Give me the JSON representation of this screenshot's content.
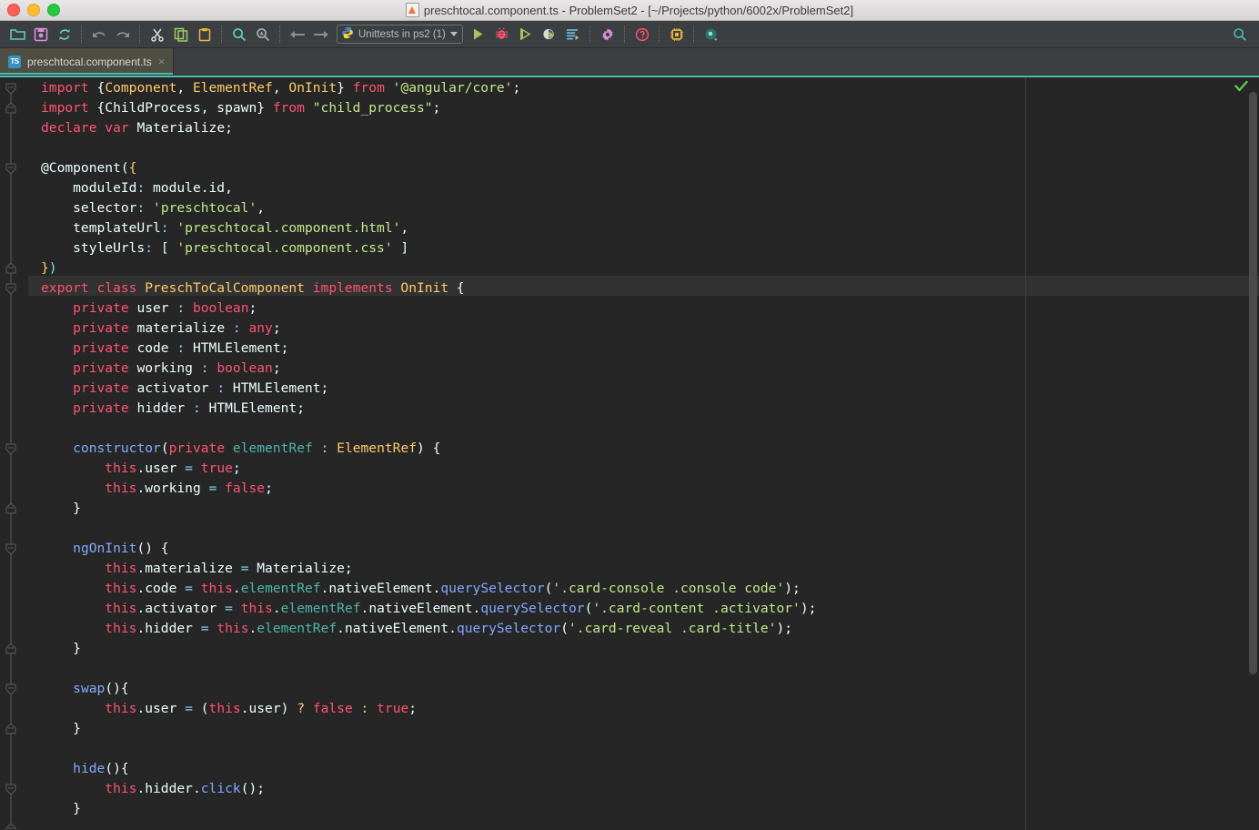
{
  "window": {
    "title": "preschtocal.component.ts - ProblemSet2 - [~/Projects/python/6002x/ProblemSet2]",
    "title_icon": "file-icon",
    "controls": [
      "close-button",
      "minimize-button",
      "zoom-button"
    ]
  },
  "toolbar": {
    "groups": [
      [
        {
          "name": "open-folder-icon",
          "glyph": "folder",
          "color": "#5fc9bf"
        },
        {
          "name": "save-all-icon",
          "glyph": "floppy",
          "color": "#d98fd9"
        },
        {
          "name": "sync-refresh-icon",
          "glyph": "refresh",
          "color": "#5fc9bf"
        }
      ],
      [
        {
          "name": "undo-icon",
          "glyph": "undo",
          "color": "#8d8d8d"
        },
        {
          "name": "redo-icon",
          "glyph": "redo",
          "color": "#8d8d8d"
        }
      ],
      [
        {
          "name": "cut-icon",
          "glyph": "scissors",
          "color": "#d8d8d8"
        },
        {
          "name": "copy-icon",
          "glyph": "copy",
          "color": "#9ccc65"
        },
        {
          "name": "paste-icon",
          "glyph": "clipboard",
          "color": "#e8b53a"
        }
      ],
      [
        {
          "name": "find-icon",
          "glyph": "magnifier",
          "color": "#5fc9bf"
        },
        {
          "name": "replace-icon",
          "glyph": "magnifier-replace",
          "color": "#a8a8a8"
        }
      ],
      [
        {
          "name": "back-icon",
          "glyph": "arrow-left",
          "color": "#8d8d8d"
        },
        {
          "name": "forward-icon",
          "glyph": "arrow-right",
          "color": "#8d8d8d"
        }
      ]
    ],
    "run_config": {
      "name": "run-configuration-selector",
      "icon": "python-icon",
      "label": "Unittests in ps2 (1)",
      "dropdown": "chevron-down-icon"
    },
    "actions": [
      {
        "name": "run-icon",
        "glyph": "play",
        "color": "#a5c261"
      },
      {
        "name": "debug-icon",
        "glyph": "bug",
        "color": "#ff5370"
      },
      {
        "name": "run-coverage-icon",
        "glyph": "play-outline",
        "color": "#a5c261"
      },
      {
        "name": "profile-icon",
        "glyph": "profile",
        "color": "#d8d8d8"
      },
      {
        "name": "run-with-console-icon",
        "glyph": "list-play",
        "color": "#6fb3d2"
      },
      {
        "name": "settings-icon",
        "glyph": "gear",
        "color": "#d98fd9"
      },
      {
        "name": "help-icon",
        "glyph": "question-circle",
        "color": "#ff5370"
      },
      {
        "name": "sdk-icon",
        "glyph": "chip",
        "color": "#e8b53a"
      },
      {
        "name": "search-everywhere-icon",
        "glyph": "circle-dot",
        "color": "#4db6ac"
      }
    ],
    "right_search": {
      "name": "search-icon",
      "glyph": "magnifier",
      "color": "#4db6ac"
    }
  },
  "tabs": [
    {
      "name": "tab-preschtocal-component-ts",
      "icon_text": "TS",
      "label": "preschtocal.component.ts",
      "close": "×",
      "active": true
    }
  ],
  "editor": {
    "status_check": "valid-checkmark",
    "caret_line": 10,
    "right_margin_column_x": 1127,
    "lines": [
      [
        {
          "t": "import ",
          "c": "kw"
        },
        {
          "t": "{",
          "c": "def"
        },
        {
          "t": "Component",
          "c": "cls"
        },
        {
          "t": ", ",
          "c": "def"
        },
        {
          "t": "ElementRef",
          "c": "cls"
        },
        {
          "t": ", ",
          "c": "def"
        },
        {
          "t": "OnInit",
          "c": "cls"
        },
        {
          "t": "} ",
          "c": "def"
        },
        {
          "t": "from ",
          "c": "kw"
        },
        {
          "t": "'@angular/core'",
          "c": "str"
        },
        {
          "t": ";",
          "c": "def"
        }
      ],
      [
        {
          "t": "import ",
          "c": "kw"
        },
        {
          "t": "{ChildProcess, spawn} ",
          "c": "def"
        },
        {
          "t": "from ",
          "c": "kw"
        },
        {
          "t": "\"child_process\"",
          "c": "str"
        },
        {
          "t": ";",
          "c": "def"
        }
      ],
      [
        {
          "t": "declare ",
          "c": "kw"
        },
        {
          "t": "var ",
          "c": "kw"
        },
        {
          "t": "Materialize;",
          "c": "def"
        }
      ],
      [],
      [
        {
          "t": "@Component(",
          "c": "def"
        },
        {
          "t": "{",
          "c": "brace-hl"
        }
      ],
      [
        {
          "t": "    moduleId",
          "c": "def"
        },
        {
          "t": ":",
          "c": "prop"
        },
        {
          "t": " module.id,",
          "c": "def"
        }
      ],
      [
        {
          "t": "    selector",
          "c": "def"
        },
        {
          "t": ":",
          "c": "prop"
        },
        {
          "t": " ",
          "c": "def"
        },
        {
          "t": "'preschtocal'",
          "c": "str"
        },
        {
          "t": ",",
          "c": "def"
        }
      ],
      [
        {
          "t": "    templateUrl",
          "c": "def"
        },
        {
          "t": ":",
          "c": "prop"
        },
        {
          "t": " ",
          "c": "def"
        },
        {
          "t": "'preschtocal.component.html'",
          "c": "str"
        },
        {
          "t": ",",
          "c": "def"
        }
      ],
      [
        {
          "t": "    styleUrls",
          "c": "def"
        },
        {
          "t": ":",
          "c": "prop"
        },
        {
          "t": " [ ",
          "c": "def"
        },
        {
          "t": "'preschtocal.component.css'",
          "c": "str"
        },
        {
          "t": " ]",
          "c": "def"
        }
      ],
      [
        {
          "t": "}",
          "c": "brace-hl"
        },
        {
          "t": ")",
          "c": "prop"
        }
      ],
      [
        {
          "t": "export ",
          "c": "kw"
        },
        {
          "t": "class ",
          "c": "kw"
        },
        {
          "t": "PreschToCalComponent ",
          "c": "cls"
        },
        {
          "t": "implements ",
          "c": "kw"
        },
        {
          "t": "OnInit",
          "c": "cls"
        },
        {
          "t": " {",
          "c": "def"
        }
      ],
      [
        {
          "t": "    ",
          "c": "def"
        },
        {
          "t": "private ",
          "c": "kw"
        },
        {
          "t": "user ",
          "c": "def"
        },
        {
          "t": ":",
          "c": "prop"
        },
        {
          "t": " ",
          "c": "def"
        },
        {
          "t": "boolean",
          "c": "kw"
        },
        {
          "t": ";",
          "c": "def"
        }
      ],
      [
        {
          "t": "    ",
          "c": "def"
        },
        {
          "t": "private ",
          "c": "kw"
        },
        {
          "t": "materialize ",
          "c": "def"
        },
        {
          "t": ":",
          "c": "prop"
        },
        {
          "t": " ",
          "c": "def"
        },
        {
          "t": "any",
          "c": "kw"
        },
        {
          "t": ";",
          "c": "def"
        }
      ],
      [
        {
          "t": "    ",
          "c": "def"
        },
        {
          "t": "private ",
          "c": "kw"
        },
        {
          "t": "code ",
          "c": "def"
        },
        {
          "t": ":",
          "c": "prop"
        },
        {
          "t": " HTMLElement;",
          "c": "def"
        }
      ],
      [
        {
          "t": "    ",
          "c": "def"
        },
        {
          "t": "private ",
          "c": "kw"
        },
        {
          "t": "working ",
          "c": "def"
        },
        {
          "t": ":",
          "c": "prop"
        },
        {
          "t": " ",
          "c": "def"
        },
        {
          "t": "boolean",
          "c": "kw"
        },
        {
          "t": ";",
          "c": "def"
        }
      ],
      [
        {
          "t": "    ",
          "c": "def"
        },
        {
          "t": "private ",
          "c": "kw"
        },
        {
          "t": "activator ",
          "c": "def"
        },
        {
          "t": ":",
          "c": "prop"
        },
        {
          "t": " HTMLElement;",
          "c": "def"
        }
      ],
      [
        {
          "t": "    ",
          "c": "def"
        },
        {
          "t": "private ",
          "c": "kw"
        },
        {
          "t": "hidder ",
          "c": "def"
        },
        {
          "t": ":",
          "c": "prop"
        },
        {
          "t": " HTMLElement;",
          "c": "def"
        }
      ],
      [],
      [
        {
          "t": "    ",
          "c": "def"
        },
        {
          "t": "constructor",
          "c": "fn"
        },
        {
          "t": "(",
          "c": "def"
        },
        {
          "t": "private ",
          "c": "kw"
        },
        {
          "t": "elementRef ",
          "c": "tealid"
        },
        {
          "t": ":",
          "c": "prop"
        },
        {
          "t": " ",
          "c": "def"
        },
        {
          "t": "ElementRef",
          "c": "cls"
        },
        {
          "t": ") {",
          "c": "def"
        }
      ],
      [
        {
          "t": "        ",
          "c": "def"
        },
        {
          "t": "this",
          "c": "kw"
        },
        {
          "t": ".user ",
          "c": "def"
        },
        {
          "t": "=",
          "c": "prop"
        },
        {
          "t": " ",
          "c": "def"
        },
        {
          "t": "true",
          "c": "kw"
        },
        {
          "t": ";",
          "c": "def"
        }
      ],
      [
        {
          "t": "        ",
          "c": "def"
        },
        {
          "t": "this",
          "c": "kw"
        },
        {
          "t": ".working ",
          "c": "def"
        },
        {
          "t": "=",
          "c": "prop"
        },
        {
          "t": " ",
          "c": "def"
        },
        {
          "t": "false",
          "c": "kw"
        },
        {
          "t": ";",
          "c": "def"
        }
      ],
      [
        {
          "t": "    }",
          "c": "def"
        }
      ],
      [],
      [
        {
          "t": "    ",
          "c": "def"
        },
        {
          "t": "ngOnInit",
          "c": "fn"
        },
        {
          "t": "() {",
          "c": "def"
        }
      ],
      [
        {
          "t": "        ",
          "c": "def"
        },
        {
          "t": "this",
          "c": "kw"
        },
        {
          "t": ".materialize ",
          "c": "def"
        },
        {
          "t": "=",
          "c": "prop"
        },
        {
          "t": " Materialize;",
          "c": "def"
        }
      ],
      [
        {
          "t": "        ",
          "c": "def"
        },
        {
          "t": "this",
          "c": "kw"
        },
        {
          "t": ".code ",
          "c": "def"
        },
        {
          "t": "=",
          "c": "prop"
        },
        {
          "t": " ",
          "c": "def"
        },
        {
          "t": "this",
          "c": "kw"
        },
        {
          "t": ".",
          "c": "def"
        },
        {
          "t": "elementRef",
          "c": "tealid"
        },
        {
          "t": ".nativeElement.",
          "c": "def"
        },
        {
          "t": "querySelector",
          "c": "fn"
        },
        {
          "t": "(",
          "c": "def"
        },
        {
          "t": "'.card-console .console code'",
          "c": "str"
        },
        {
          "t": ");",
          "c": "def"
        }
      ],
      [
        {
          "t": "        ",
          "c": "def"
        },
        {
          "t": "this",
          "c": "kw"
        },
        {
          "t": ".activator ",
          "c": "def"
        },
        {
          "t": "=",
          "c": "prop"
        },
        {
          "t": " ",
          "c": "def"
        },
        {
          "t": "this",
          "c": "kw"
        },
        {
          "t": ".",
          "c": "def"
        },
        {
          "t": "elementRef",
          "c": "tealid"
        },
        {
          "t": ".nativeElement.",
          "c": "def"
        },
        {
          "t": "querySelector",
          "c": "fn"
        },
        {
          "t": "(",
          "c": "def"
        },
        {
          "t": "'.card-content .activator'",
          "c": "str"
        },
        {
          "t": ");",
          "c": "def"
        }
      ],
      [
        {
          "t": "        ",
          "c": "def"
        },
        {
          "t": "this",
          "c": "kw"
        },
        {
          "t": ".hidder ",
          "c": "def"
        },
        {
          "t": "=",
          "c": "prop"
        },
        {
          "t": " ",
          "c": "def"
        },
        {
          "t": "this",
          "c": "kw"
        },
        {
          "t": ".",
          "c": "def"
        },
        {
          "t": "elementRef",
          "c": "tealid"
        },
        {
          "t": ".nativeElement.",
          "c": "def"
        },
        {
          "t": "querySelector",
          "c": "fn"
        },
        {
          "t": "(",
          "c": "def"
        },
        {
          "t": "'.card-reveal .card-title'",
          "c": "str"
        },
        {
          "t": ");",
          "c": "def"
        }
      ],
      [
        {
          "t": "    }",
          "c": "def"
        }
      ],
      [],
      [
        {
          "t": "    ",
          "c": "def"
        },
        {
          "t": "swap",
          "c": "fn"
        },
        {
          "t": "(){",
          "c": "def"
        }
      ],
      [
        {
          "t": "        ",
          "c": "def"
        },
        {
          "t": "this",
          "c": "kw"
        },
        {
          "t": ".user ",
          "c": "def"
        },
        {
          "t": "=",
          "c": "prop"
        },
        {
          "t": " (",
          "c": "def"
        },
        {
          "t": "this",
          "c": "kw"
        },
        {
          "t": ".user) ",
          "c": "def"
        },
        {
          "t": "?",
          "c": "cls"
        },
        {
          "t": " ",
          "c": "def"
        },
        {
          "t": "false",
          "c": "kw"
        },
        {
          "t": " ",
          "c": "def"
        },
        {
          "t": ":",
          "c": "cls"
        },
        {
          "t": " ",
          "c": "def"
        },
        {
          "t": "true",
          "c": "kw"
        },
        {
          "t": ";",
          "c": "def"
        }
      ],
      [
        {
          "t": "    }",
          "c": "def"
        }
      ],
      [],
      [
        {
          "t": "    ",
          "c": "def"
        },
        {
          "t": "hide",
          "c": "fn"
        },
        {
          "t": "(){",
          "c": "def"
        }
      ],
      [
        {
          "t": "        ",
          "c": "def"
        },
        {
          "t": "this",
          "c": "kw"
        },
        {
          "t": ".hidder.",
          "c": "def"
        },
        {
          "t": "click",
          "c": "fn"
        },
        {
          "t": "();",
          "c": "def"
        }
      ],
      [
        {
          "t": "    }",
          "c": "def"
        }
      ]
    ],
    "fold_markers": [
      {
        "line": 0,
        "type": "start"
      },
      {
        "line": 1,
        "type": "end"
      },
      {
        "line": 4,
        "type": "start"
      },
      {
        "line": 9,
        "type": "end"
      },
      {
        "line": 10,
        "type": "start"
      },
      {
        "line": 18,
        "type": "start"
      },
      {
        "line": 21,
        "type": "end"
      },
      {
        "line": 23,
        "type": "start"
      },
      {
        "line": 28,
        "type": "end"
      },
      {
        "line": 30,
        "type": "start"
      },
      {
        "line": 32,
        "type": "end"
      },
      {
        "line": 35,
        "type": "start"
      },
      {
        "line": 37,
        "type": "end"
      }
    ]
  },
  "colors": {
    "editor_bg": "#262626",
    "chrome_bg": "#3c3f41",
    "caret_line": "#323232",
    "accent_teal": "#4dbfb0",
    "keyword": "#ff5370",
    "string": "#c3e88d",
    "class": "#ffcb6b",
    "function": "#82aaff",
    "punct": "#89ddff",
    "default_text": "#eeffff",
    "member_teal": "#4db6ac",
    "check_green": "#62c554"
  }
}
